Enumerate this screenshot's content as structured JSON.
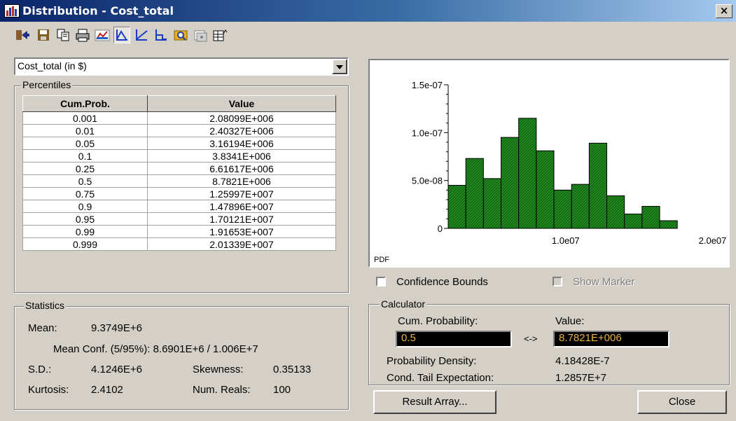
{
  "window": {
    "title": "Distribution - Cost_total",
    "close_label": "×"
  },
  "toolbar": {
    "icons": [
      "export-icon",
      "save-icon",
      "copy-icon",
      "print-icon",
      "graph-settings-icon",
      "pdf-icon",
      "cdf-icon",
      "ccdf-icon",
      "view-icon",
      "properties-icon",
      "table-icon"
    ]
  },
  "variable_select": {
    "value": "Cost_total (in $)"
  },
  "percentiles": {
    "label": "Percentiles",
    "headers": [
      "Cum.Prob.",
      "Value"
    ],
    "rows": [
      [
        "0.001",
        "2.08099E+006"
      ],
      [
        "0.01",
        "2.40327E+006"
      ],
      [
        "0.05",
        "3.16194E+006"
      ],
      [
        "0.1",
        "3.8341E+006"
      ],
      [
        "0.25",
        "6.61617E+006"
      ],
      [
        "0.5",
        "8.7821E+006"
      ],
      [
        "0.75",
        "1.25997E+007"
      ],
      [
        "0.9",
        "1.47896E+007"
      ],
      [
        "0.95",
        "1.70121E+007"
      ],
      [
        "0.99",
        "1.91653E+007"
      ],
      [
        "0.999",
        "2.01339E+007"
      ]
    ]
  },
  "statistics": {
    "label": "Statistics",
    "mean_label": "Mean:",
    "mean": "9.3749E+6",
    "mean_conf": "Mean Conf. (5/95%): 8.6901E+6 / 1.006E+7",
    "sd_label": "S.D.:",
    "sd": "4.1246E+6",
    "skew_label": "Skewness:",
    "skew": "0.35133",
    "kurt_label": "Kurtosis:",
    "kurt": "2.4102",
    "reals_label": "Num. Reals:",
    "reals": "100"
  },
  "chart_data": {
    "type": "bar",
    "ylabel_text": "PDF",
    "y_ticks": [
      "1.5e-07",
      "1.0e-07",
      "5.0e-08",
      "0"
    ],
    "x_ticks": [
      "1.0e07",
      "2.0e07"
    ],
    "xlim": [
      2000000.0,
      20500000.0
    ],
    "ylim": [
      0,
      1.5e-07
    ],
    "bar_color": "#1e8c1e",
    "bins": [
      {
        "x0": 2000000.0,
        "x1": 3200000.0,
        "y": 4.5e-08
      },
      {
        "x0": 3200000.0,
        "x1": 4400000.0,
        "y": 7.3e-08
      },
      {
        "x0": 4400000.0,
        "x1": 5600000.0,
        "y": 5.2e-08
      },
      {
        "x0": 5600000.0,
        "x1": 6800000.0,
        "y": 9.5e-08
      },
      {
        "x0": 6800000.0,
        "x1": 8000000.0,
        "y": 1.15e-07
      },
      {
        "x0": 8000000.0,
        "x1": 9200000.0,
        "y": 8.1e-08
      },
      {
        "x0": 9200000.0,
        "x1": 10400000.0,
        "y": 4e-08
      },
      {
        "x0": 10400000.0,
        "x1": 11600000.0,
        "y": 4.6e-08
      },
      {
        "x0": 11600000.0,
        "x1": 12800000.0,
        "y": 8.9e-08
      },
      {
        "x0": 12800000.0,
        "x1": 14000000.0,
        "y": 3.4e-08
      },
      {
        "x0": 14000000.0,
        "x1": 15200000.0,
        "y": 1.5e-08
      },
      {
        "x0": 15200000.0,
        "x1": 16400000.0,
        "y": 2.3e-08
      },
      {
        "x0": 16400000.0,
        "x1": 17600000.0,
        "y": 8e-09
      }
    ]
  },
  "options": {
    "confidence_bounds": "Confidence Bounds",
    "show_marker": "Show Marker"
  },
  "calculator": {
    "label": "Calculator",
    "cum_prob_label": "Cum. Probability:",
    "cum_prob": "0.5",
    "arrow": "<->",
    "value_label": "Value:",
    "value": "8.7821E+006",
    "density_label": "Probability Density:",
    "density": "4.18428E-7",
    "cte_label": "Cond. Tail Expectation:",
    "cte": "1.2857E+7"
  },
  "buttons": {
    "result_array": "Result Array...",
    "close": "Close"
  }
}
